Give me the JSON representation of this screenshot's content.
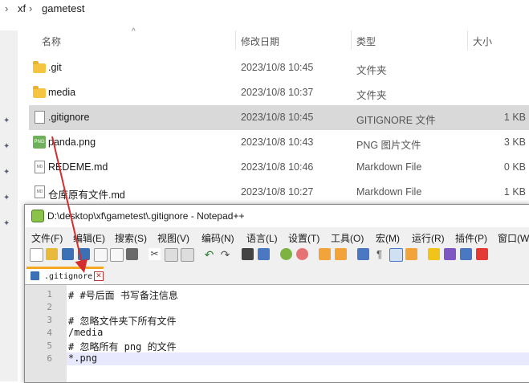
{
  "breadcrumb": [
    "xf",
    "gametest"
  ],
  "columns": {
    "name": "名称",
    "date": "修改日期",
    "type": "类型",
    "size": "大小"
  },
  "files": [
    {
      "name": ".git",
      "date": "2023/10/8 10:45",
      "type": "文件夹",
      "size": "",
      "icon": "folder-icon"
    },
    {
      "name": "media",
      "date": "2023/10/8 10:37",
      "type": "文件夹",
      "size": "",
      "icon": "folder-icon"
    },
    {
      "name": ".gitignore",
      "date": "2023/10/8 10:45",
      "type": "GITIGNORE 文件",
      "size": "1 KB",
      "icon": "file-icon"
    },
    {
      "name": "panda.png",
      "date": "2023/10/8 10:43",
      "type": "PNG 图片文件",
      "size": "3 KB",
      "icon": "image-file-icon"
    },
    {
      "name": "REDEME.md",
      "date": "2023/10/8 10:46",
      "type": "Markdown File",
      "size": "0 KB",
      "icon": "markdown-file-icon"
    },
    {
      "name": "仓库原有文件.md",
      "date": "2023/10/8 10:27",
      "type": "Markdown File",
      "size": "1 KB",
      "icon": "markdown-file-icon"
    }
  ],
  "notepad": {
    "title": "D:\\desktop\\xf\\gametest\\.gitignore - Notepad++",
    "menu": [
      "文件(F)",
      "编辑(E)",
      "搜索(S)",
      "视图(V)",
      "编码(N)",
      "语言(L)",
      "设置(T)",
      "工具(O)",
      "宏(M)",
      "运行(R)",
      "插件(P)",
      "窗口(W"
    ],
    "tab_label": ".gitignore",
    "lines": [
      "# #号后面 书写备注信息",
      "",
      "# 忽略文件夹下所有文件",
      "/media",
      "# 忽略所有 png 的文件",
      "*.png"
    ],
    "line_numbers": [
      "1",
      "2",
      "3",
      "4",
      "5",
      "6"
    ]
  },
  "colors": {
    "accent_tab": "#f5a623",
    "annotation_arrow": "#d32f2f",
    "current_line": "#e8e8ff"
  }
}
